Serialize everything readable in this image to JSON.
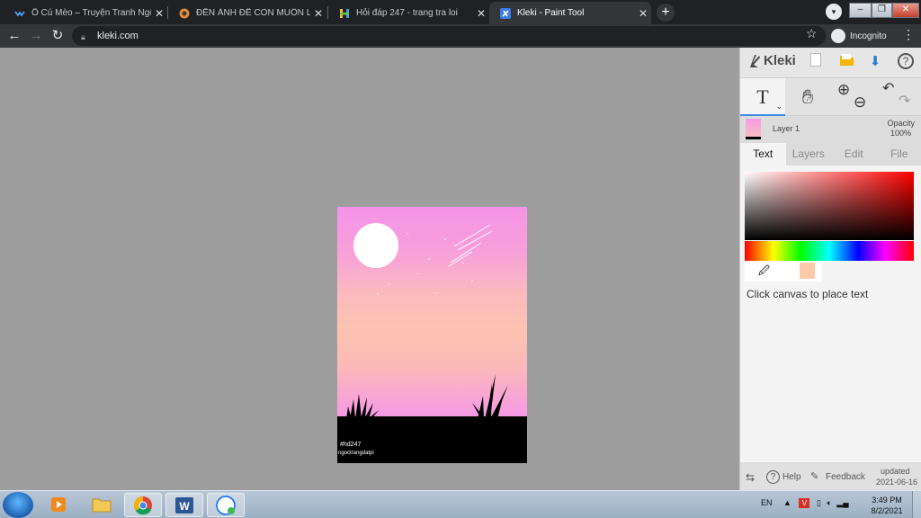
{
  "browser": {
    "tabs": [
      {
        "title": "Ổ Cú Mèo – Truyện Tranh Ngôn",
        "active": false
      },
      {
        "title": "ĐẾN ẢNH ĐỂ CÒN MUỐN LY HÔ",
        "active": false
      },
      {
        "title": "Hỏi đáp 247 - trang tra loi",
        "active": false
      },
      {
        "title": "Kleki - Paint Tool",
        "active": true
      }
    ],
    "url": "kleki.com",
    "incognito_label": "Incognito",
    "new_tab": "+"
  },
  "artwork": {
    "signature_line1": "#hd247",
    "signature_line2": "ngoctrangdatpi"
  },
  "app": {
    "name": "Kleki",
    "layer": {
      "name": "Layer 1",
      "opacity_label": "Opacity",
      "opacity_value": "100%"
    },
    "tabs": [
      "Text",
      "Layers",
      "Edit",
      "File"
    ],
    "active_tab": "Text",
    "hex_symbol": "#",
    "current_color": "#fdc9a8",
    "hint": "Click canvas to place text",
    "footer": {
      "help": "Help",
      "feedback": "Feedback",
      "updated_label": "updated",
      "updated_date": "2021-06-16"
    }
  },
  "taskbar": {
    "language": "EN",
    "time": "3:49 PM",
    "date": "8/2/2021",
    "apps": [
      "media-player",
      "file-explorer",
      "chrome",
      "word",
      "zalo"
    ]
  }
}
